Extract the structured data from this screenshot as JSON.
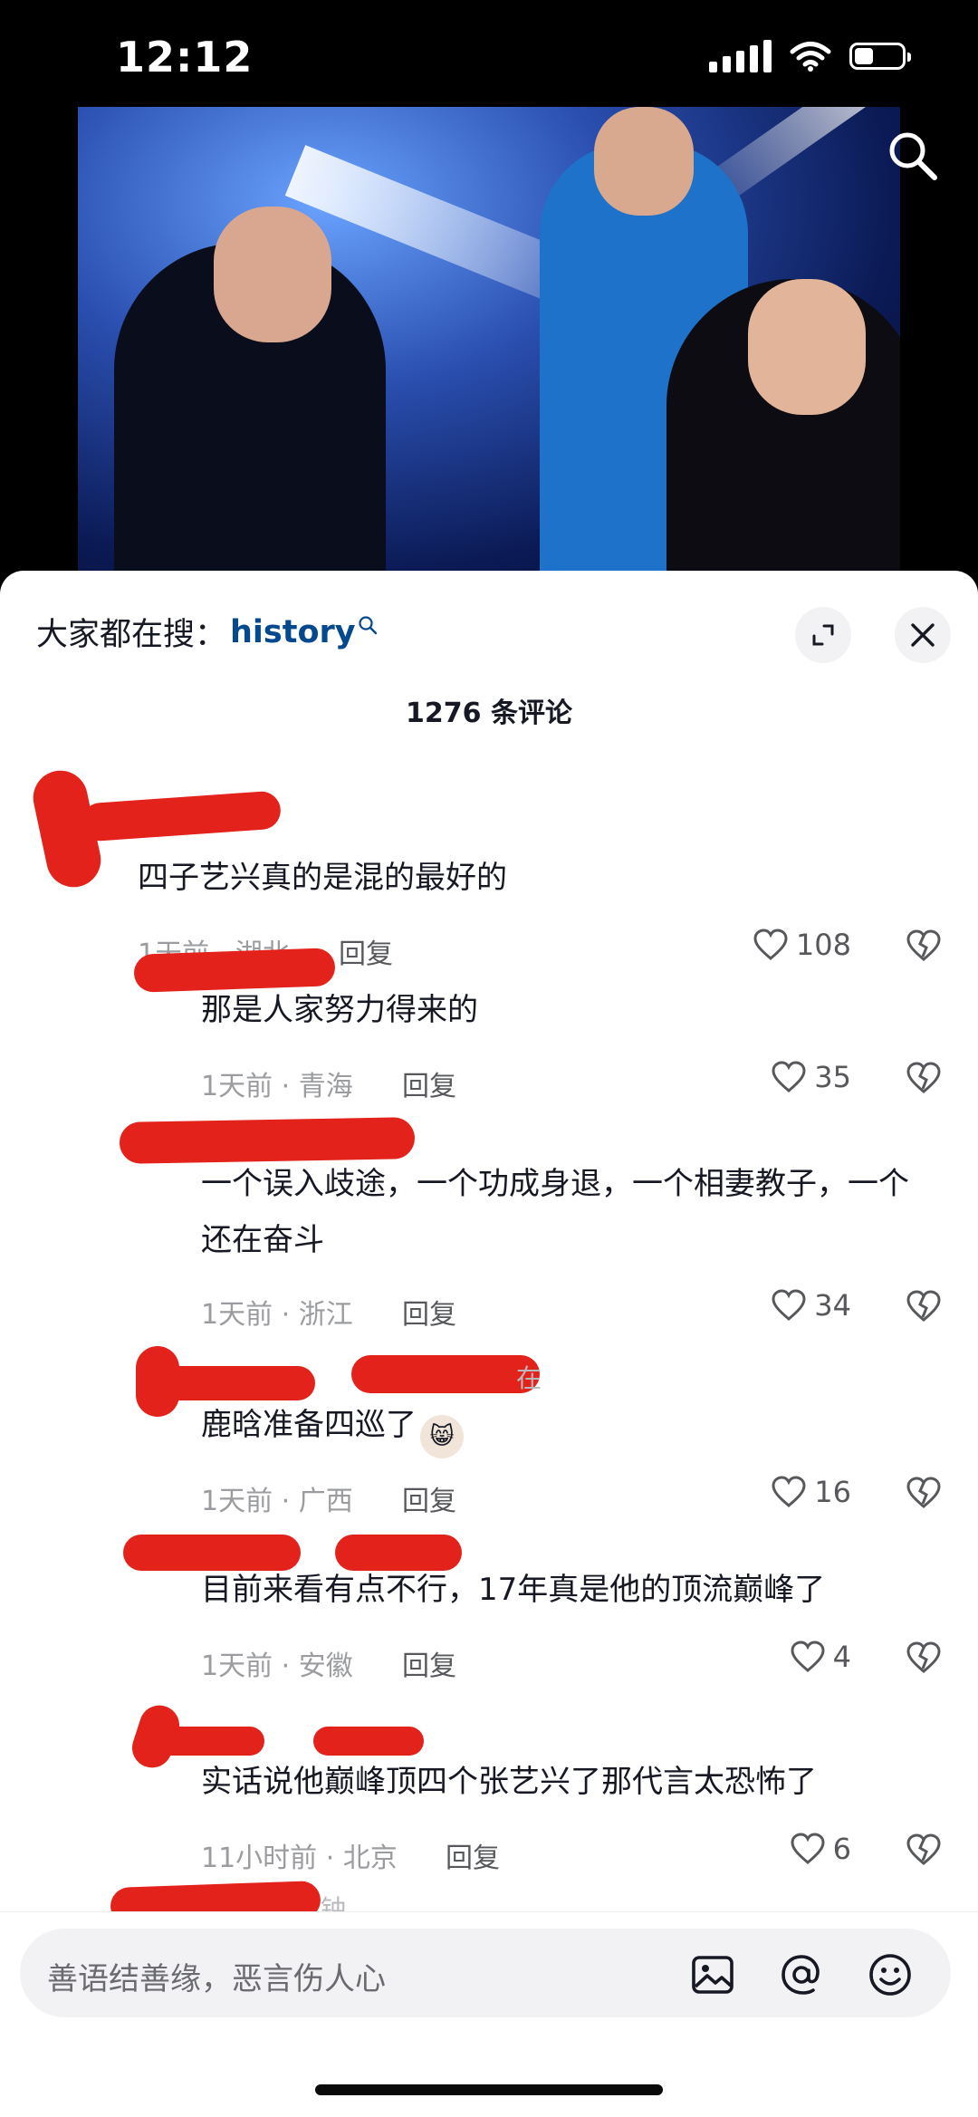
{
  "status": {
    "time": "12:12",
    "battery_level": 0.4
  },
  "search_bar": {
    "prefix": "大家都在搜：",
    "keyword": "history"
  },
  "comments_count": "1276 条评论",
  "comments": [
    {
      "text": "四子艺兴真的是混的最好的",
      "meta": "1天前 · 湖北",
      "reply": "回复",
      "likes": "108"
    },
    {
      "text": "那是人家努力得来的",
      "meta": "1天前 · 青海",
      "reply": "回复",
      "likes": "35"
    },
    {
      "text": "一个误入歧途，一个功成身退，一个相妻教子，一个还在奋斗",
      "meta": "1天前 · 浙江",
      "reply": "回复",
      "likes": "34"
    },
    {
      "text": "鹿晗准备四巡了",
      "meta": "1天前 · 广西",
      "reply": "回复",
      "likes": "16"
    },
    {
      "text": "目前来看有点不行，17年真是他的顶流巅峰了",
      "meta": "1天前 · 安徽",
      "reply": "回复",
      "likes": "4"
    },
    {
      "text": "实话说他巅峰顶四个张艺兴了那代言太恐怖了",
      "meta": "11小时前 · 北京",
      "reply": "回复",
      "likes": "6"
    }
  ],
  "faint_labels": {
    "c4_reply_to": "在",
    "c7_time": "钟"
  },
  "input": {
    "placeholder": "善语结善缘，恶言伤人心"
  },
  "icons": [
    "search-icon",
    "expand-icon",
    "close-icon",
    "heart-icon",
    "dislike-icon",
    "image-icon",
    "at-icon",
    "emoji-icon"
  ],
  "colors": {
    "keyword": "#04498d",
    "redaction": "#e3221b"
  }
}
